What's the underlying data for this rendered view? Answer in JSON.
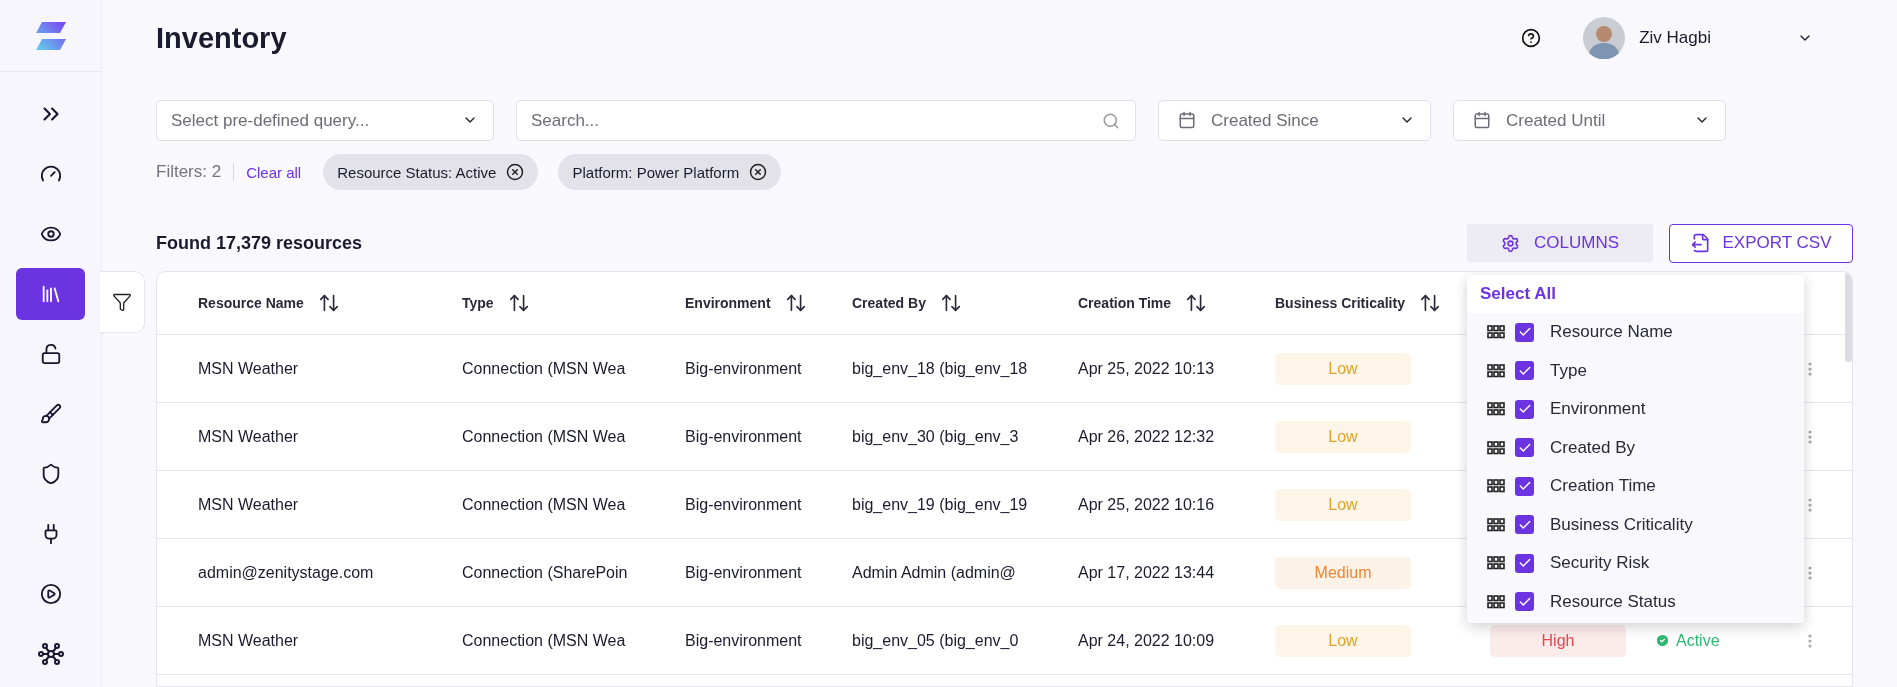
{
  "sidebar": {
    "items": [
      {
        "selected": false
      },
      {
        "selected": false
      },
      {
        "selected": false
      },
      {
        "selected": true
      },
      {
        "selected": false
      },
      {
        "selected": false
      },
      {
        "selected": false
      },
      {
        "selected": false
      },
      {
        "selected": false
      },
      {
        "selected": false
      }
    ]
  },
  "header": {
    "title": "Inventory",
    "user": {
      "name": "Ziv Hagbi"
    }
  },
  "toolbar": {
    "query_select": {
      "placeholder": "Select pre-defined query..."
    },
    "search": {
      "placeholder": "Search..."
    },
    "created_since": {
      "placeholder": "Created Since"
    },
    "created_until": {
      "placeholder": "Created Until"
    }
  },
  "filters": {
    "count": "Filters: 2",
    "clear": "Clear all",
    "chips": [
      "Resource Status: Active",
      "Platform: Power Platform"
    ]
  },
  "results": {
    "found": "Found 17,379 resources",
    "columns_button": "COLUMNS",
    "export_button": "EXPORT CSV"
  },
  "table": {
    "columns": [
      "Resource Name",
      "Type",
      "Environment",
      "Created By",
      "Creation Time",
      "Business Criticality"
    ],
    "rows": [
      {
        "name": "MSN Weather",
        "type": "Connection (MSN Wea",
        "environment": "Big-environment",
        "created_by": "big_env_18 (big_env_18",
        "created": "Apr 25, 2022 10:13",
        "criticality": {
          "label": "Low",
          "color": "#e0a22a"
        }
      },
      {
        "name": "MSN Weather",
        "type": "Connection (MSN Wea",
        "environment": "Big-environment",
        "created_by": "big_env_30 (big_env_3",
        "created": "Apr 26, 2022 12:32",
        "criticality": {
          "label": "Low",
          "color": "#e0a22a"
        }
      },
      {
        "name": "MSN Weather",
        "type": "Connection (MSN Wea",
        "environment": "Big-environment",
        "created_by": "big_env_19 (big_env_19",
        "created": "Apr 25, 2022 10:16",
        "criticality": {
          "label": "Low",
          "color": "#e0a22a"
        }
      },
      {
        "name": "admin@zenitystage.com",
        "type": "Connection (SharePoin",
        "environment": "Big-environment",
        "created_by": "Admin Admin (admin@",
        "created": "Apr 17, 2022 13:44",
        "criticality": {
          "label": "Medium",
          "color": "#f0852f"
        }
      },
      {
        "name": "MSN Weather",
        "type": "Connection (MSN Wea",
        "environment": "Big-environment",
        "created_by": "big_env_05 (big_env_0",
        "created": "Apr 24, 2022 10:09",
        "criticality": {
          "label": "Low",
          "color": "#e0a22a"
        },
        "security_risk": {
          "label": "High",
          "color": "#e5484d"
        },
        "status": {
          "label": "Active",
          "color": "#2eb872"
        }
      }
    ]
  },
  "columns_menu": {
    "select_all": "Select All",
    "items": [
      {
        "label": "Resource Name",
        "checked": true
      },
      {
        "label": "Type",
        "checked": true
      },
      {
        "label": "Environment",
        "checked": true
      },
      {
        "label": "Created By",
        "checked": true
      },
      {
        "label": "Creation Time",
        "checked": true
      },
      {
        "label": "Business Criticality",
        "checked": true
      },
      {
        "label": "Security Risk",
        "checked": true
      },
      {
        "label": "Resource Status",
        "checked": true
      }
    ]
  }
}
